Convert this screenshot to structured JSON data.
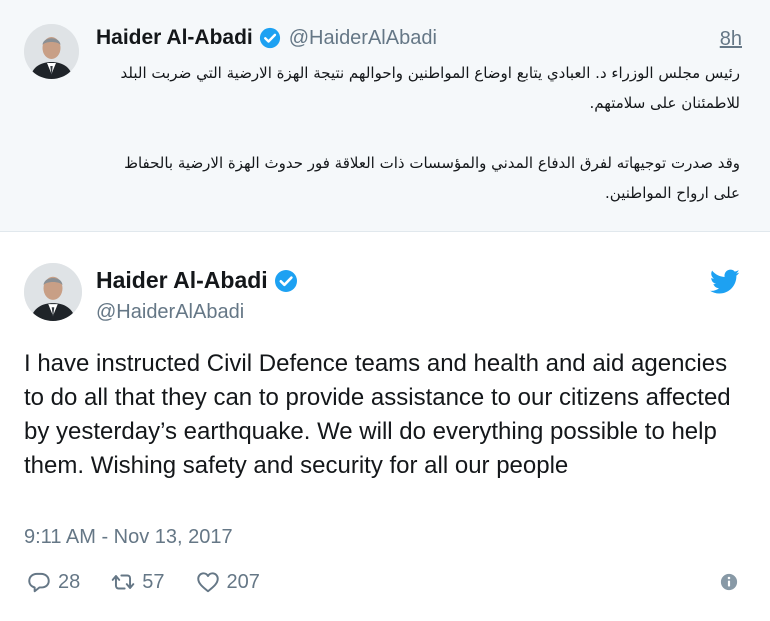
{
  "parent": {
    "name": "Haider Al-Abadi",
    "handle": "@HaiderAlAbadi",
    "time": "8h",
    "text_para1": "رئيس مجلس الوزراء د. العبادي يتابع اوضاع المواطنين واحوالهم نتيجة الهزة الارضية التي ضربت البلد للاطمئنان على سلامتهم.",
    "text_para2": "وقد صدرت توجيهاته لفرق الدفاع المدني والمؤسسات ذات العلاقة فور حدوث الهزة الارضية بالحفاظ على ارواح المواطنين."
  },
  "tweet": {
    "name": "Haider Al-Abadi",
    "handle": "@HaiderAlAbadi",
    "text": "I have instructed Civil Defence teams and health and aid agencies to do all that they can to provide assistance to our citizens affected by yesterday’s earthquake. We will do everything possible to help them. Wishing safety and security for all our people",
    "date": "9:11 AM - Nov 13, 2017",
    "replies": "28",
    "retweets": "57",
    "likes": "207"
  },
  "icons": {
    "verified": "verified-badge-icon",
    "twitter": "twitter-bird-icon",
    "reply": "reply-icon",
    "retweet": "retweet-icon",
    "like": "heart-icon",
    "info": "info-icon"
  },
  "colors": {
    "accent": "#1da1f2",
    "muted": "#657786",
    "text": "#14171a",
    "parent_bg": "#f5f8fa"
  }
}
